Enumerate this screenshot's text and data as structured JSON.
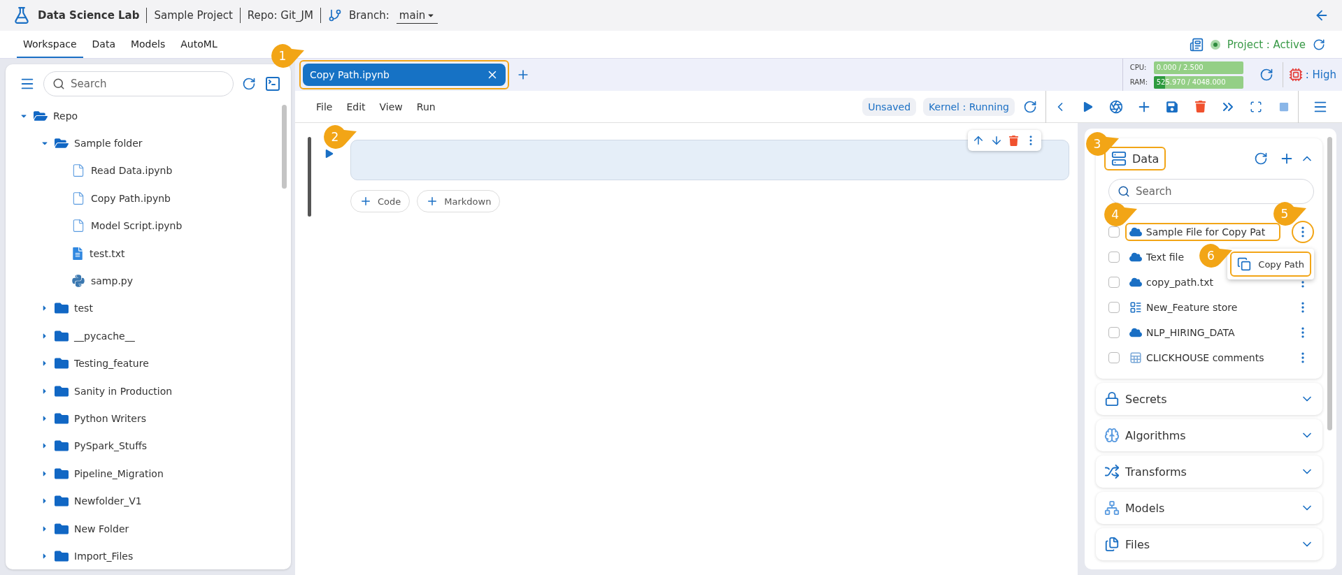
{
  "header": {
    "app_title": "Data Science Lab",
    "project": "Sample Project",
    "repo": "Repo: Git_JM",
    "branch_label": "Branch:",
    "branch": "main"
  },
  "nav_tabs": [
    {
      "label": "Workspace",
      "selected": true
    },
    {
      "label": "Data",
      "selected": false
    },
    {
      "label": "Models",
      "selected": false
    },
    {
      "label": "AutoML",
      "selected": false
    }
  ],
  "project_status": "Project : Active",
  "sidebar": {
    "search": {
      "placeholder": "Search"
    },
    "tree": [
      {
        "label": "Repo",
        "kind": "folder",
        "expanded": true,
        "children": [
          {
            "label": "Sample folder",
            "kind": "folder",
            "expanded": true,
            "children": [
              {
                "label": "Read Data.ipynb",
                "kind": "notebook"
              },
              {
                "label": "Copy Path.ipynb",
                "kind": "notebook"
              },
              {
                "label": "Model Script.ipynb",
                "kind": "notebook"
              },
              {
                "label": "test.txt",
                "kind": "text"
              },
              {
                "label": "samp.py",
                "kind": "python"
              }
            ]
          },
          {
            "label": "test",
            "kind": "folder",
            "expanded": false
          },
          {
            "label": "__pycache__",
            "kind": "folder",
            "expanded": false
          },
          {
            "label": "Testing_feature",
            "kind": "folder",
            "expanded": false
          },
          {
            "label": "Sanity in Production",
            "kind": "folder",
            "expanded": false
          },
          {
            "label": "Python Writers",
            "kind": "folder",
            "expanded": false
          },
          {
            "label": "PySpark_Stuffs",
            "kind": "folder",
            "expanded": false
          },
          {
            "label": "Pipeline_Migration",
            "kind": "folder",
            "expanded": false
          },
          {
            "label": "Newfolder_V1",
            "kind": "folder",
            "expanded": false
          },
          {
            "label": "New Folder",
            "kind": "folder",
            "expanded": false
          },
          {
            "label": "Import_Files",
            "kind": "folder",
            "expanded": false
          }
        ]
      }
    ]
  },
  "notebook_tabs": [
    {
      "label": "Copy Path.ipynb",
      "selected": true,
      "callout": "1"
    }
  ],
  "resources": {
    "cpu": {
      "label": "CPU:",
      "reading": "0.000 / 2.500",
      "level": 0
    },
    "ram": {
      "label": "RAM:",
      "reading": "525.970 / 4048.000",
      "level": 0.13
    },
    "priority": ": High"
  },
  "menu": [
    "File",
    "Edit",
    "View",
    "Run"
  ],
  "kernel": {
    "save_state": "Unsaved",
    "status": "Kernel : Running"
  },
  "cell": {
    "callout": "2"
  },
  "add_cell_buttons": [
    "Code",
    "Markdown"
  ],
  "data_panel": {
    "title": "Data",
    "callout": "3",
    "expanded": true,
    "search": {
      "placeholder": "Search"
    },
    "items": [
      {
        "label": "Sample File for Copy Pat",
        "kind": "cloud",
        "checked": false,
        "callout": "4",
        "menu_callout": "5"
      },
      {
        "label": "Text file",
        "kind": "cloud",
        "checked": false
      },
      {
        "label": "copy_path.txt",
        "kind": "cloud",
        "checked": false
      },
      {
        "label": "New_Feature store",
        "kind": "feature_store",
        "checked": false
      },
      {
        "label": "NLP_HIRING_DATA",
        "kind": "cloud",
        "checked": false
      },
      {
        "label": "CLICKHOUSE comments",
        "kind": "sheet",
        "checked": false
      }
    ],
    "context_menu": {
      "label": "Copy Path",
      "callout": "6"
    }
  },
  "sections": [
    {
      "title": "Secrets",
      "kind": "secrets",
      "expanded": false
    },
    {
      "title": "Algorithms",
      "kind": "algorithms",
      "expanded": false
    },
    {
      "title": "Transforms",
      "kind": "transforms",
      "expanded": false
    },
    {
      "title": "Models",
      "kind": "models",
      "expanded": false
    },
    {
      "title": "Files",
      "kind": "files",
      "expanded": false
    }
  ]
}
